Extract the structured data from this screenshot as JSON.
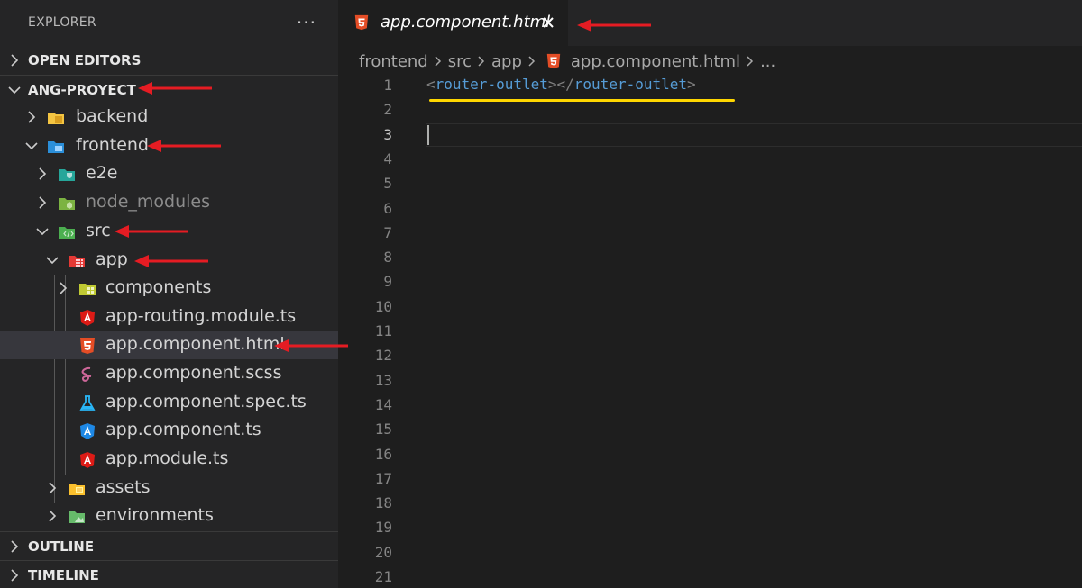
{
  "sidebar": {
    "title": "EXPLORER",
    "more": "···",
    "sections": {
      "open_editors": "OPEN EDITORS",
      "project": "ANG-PROYECT",
      "outline": "OUTLINE",
      "timeline": "TIMELINE"
    },
    "tree": {
      "backend": "backend",
      "frontend": "frontend",
      "e2e": "e2e",
      "node_modules": "node_modules",
      "src": "src",
      "app": "app",
      "components": "components",
      "routing": "app-routing.module.ts",
      "component_html": "app.component.html",
      "component_scss": "app.component.scss",
      "component_spec": "app.component.spec.ts",
      "component_ts": "app.component.ts",
      "module": "app.module.ts",
      "assets": "assets",
      "environments": "environments"
    }
  },
  "editor": {
    "tab_label": "app.component.html",
    "breadcrumb": {
      "part1": "frontend",
      "part2": "src",
      "part3": "app",
      "file": "app.component.html",
      "more": "..."
    },
    "line_numbers": [
      "1",
      "2",
      "3",
      "4",
      "5",
      "6",
      "7",
      "8",
      "9",
      "10",
      "11",
      "12",
      "13",
      "14",
      "15",
      "16",
      "17",
      "18",
      "19",
      "20",
      "21"
    ],
    "code": {
      "open_lt": "<",
      "open_tag": "router-outlet",
      "open_gt": ">",
      "close_lt": "</",
      "close_tag": "router-outlet",
      "close_gt": ">"
    }
  },
  "colors": {
    "annotation_arrow": "#e51c23",
    "highlight_underline": "#ffd700",
    "html_icon": "#e44d26",
    "angular_icon": "#dd1b16"
  }
}
